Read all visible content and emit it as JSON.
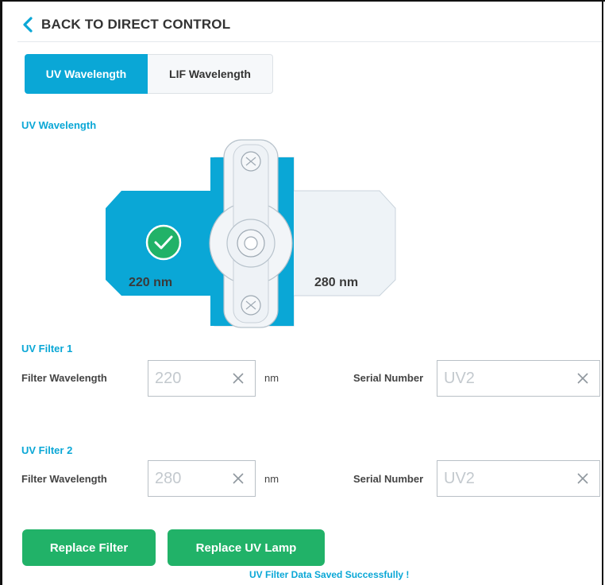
{
  "nav": {
    "back_label": "BACK TO DIRECT CONTROL"
  },
  "tabs": [
    {
      "label": "UV Wavelength",
      "active": true
    },
    {
      "label": "LIF Wavelength",
      "active": false
    }
  ],
  "section_title": "UV Wavelength",
  "filter_wheel": {
    "left_label": "220 nm",
    "right_label": "280 nm",
    "selected": "220 nm"
  },
  "filter1": {
    "title": "UV Filter 1",
    "wavelength_label": "Filter Wavelength",
    "wavelength_value": "220",
    "unit": "nm",
    "serial_label": "Serial Number",
    "serial_value": "UV2"
  },
  "filter2": {
    "title": "UV Filter 2",
    "wavelength_label": "Filter Wavelength",
    "wavelength_value": "280",
    "unit": "nm",
    "serial_label": "Serial Number",
    "serial_value": "UV2"
  },
  "buttons": {
    "replace_filter": "Replace Filter",
    "replace_lamp": "Replace UV Lamp"
  },
  "status_message": "UV Filter Data Saved Successfully !",
  "colors": {
    "accent": "#0aa7d6",
    "success": "#21b268",
    "panel": "#eef3f7"
  },
  "icons": [
    "chevron-left-icon",
    "check-circle-icon",
    "close-icon",
    "screw-icon"
  ]
}
